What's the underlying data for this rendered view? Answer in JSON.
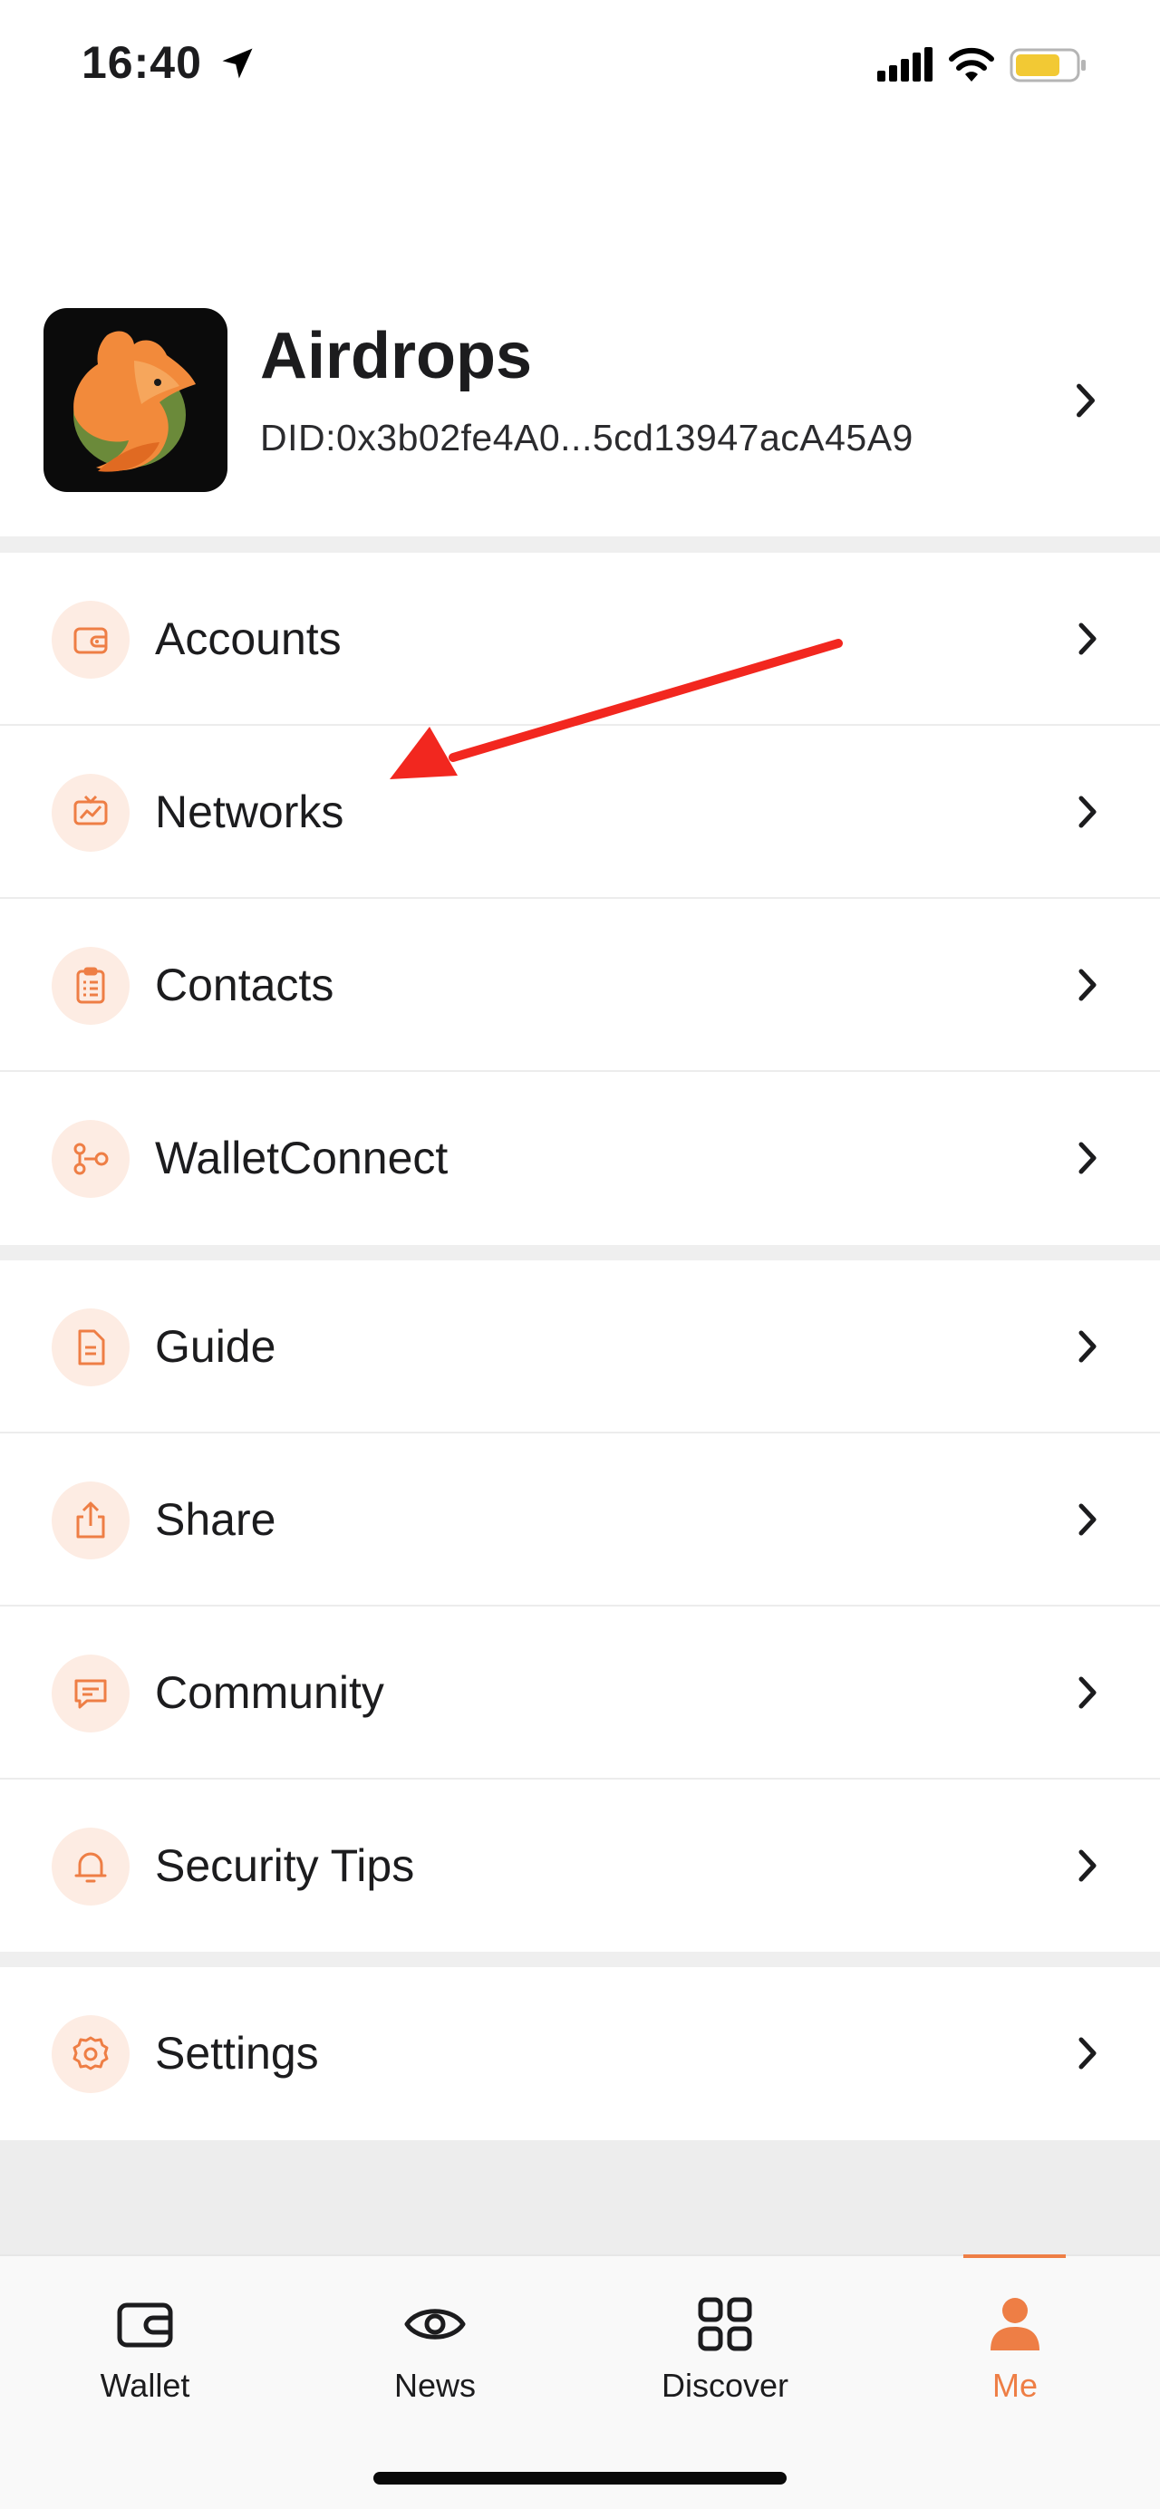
{
  "status_bar": {
    "time": "16:40",
    "icons": [
      "location-arrow-icon",
      "signal-icon",
      "wifi-icon",
      "battery-icon"
    ]
  },
  "profile": {
    "name": "Airdrops",
    "did": "DID:0x3b02fe4A0...5cd13947acA45A9",
    "avatar": "fox-logo"
  },
  "menu_groups": [
    [
      {
        "label": "Accounts",
        "icon": "wallet-icon"
      },
      {
        "label": "Networks",
        "icon": "network-chart-icon"
      },
      {
        "label": "Contacts",
        "icon": "clipboard-list-icon"
      },
      {
        "label": "WalletConnect",
        "icon": "connect-nodes-icon"
      }
    ],
    [
      {
        "label": "Guide",
        "icon": "document-icon"
      },
      {
        "label": "Share",
        "icon": "share-icon"
      },
      {
        "label": "Community",
        "icon": "chat-icon"
      },
      {
        "label": "Security Tips",
        "icon": "bell-icon"
      }
    ],
    [
      {
        "label": "Settings",
        "icon": "gear-icon"
      }
    ]
  ],
  "tab_bar": {
    "tabs": [
      {
        "label": "Wallet",
        "icon": "wallet-icon"
      },
      {
        "label": "News",
        "icon": "eye-icon"
      },
      {
        "label": "Discover",
        "icon": "grid-icon"
      },
      {
        "label": "Me",
        "icon": "person-icon",
        "active": true
      }
    ]
  },
  "colors": {
    "accent": "#ee7e45",
    "icon_bg": "#fdece3",
    "annotation": "#f2271f",
    "separator": "#efefef"
  }
}
